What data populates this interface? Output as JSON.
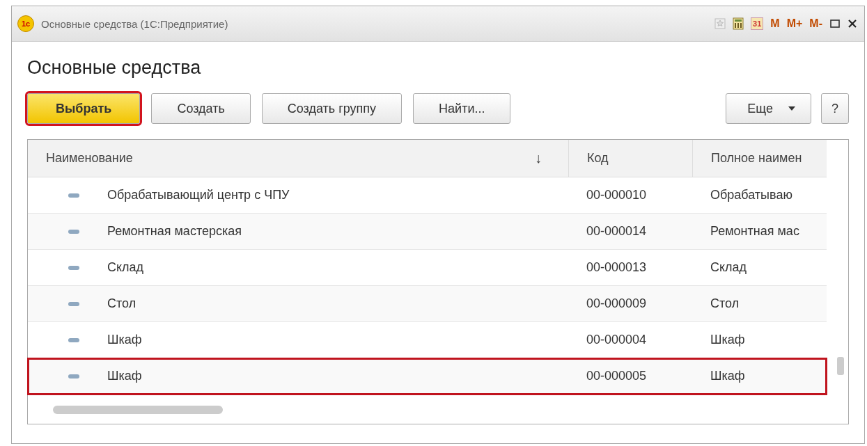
{
  "window": {
    "logo": "1с",
    "title": "Основные средства  (1С:Предприятие)",
    "calendar_day": "31",
    "memory_buttons": [
      "M",
      "M+",
      "M-"
    ]
  },
  "page_title": "Основные средства",
  "buttons": [
    {
      "label": "Выбрать",
      "kind": "default",
      "highlighted": true
    },
    {
      "label": "Создать",
      "kind": "plain",
      "highlighted": false
    },
    {
      "label": "Создать группу",
      "kind": "plain",
      "highlighted": false
    },
    {
      "label": "Найти...",
      "kind": "plain",
      "highlighted": false
    },
    {
      "label": "Еще",
      "kind": "menu",
      "highlighted": false
    },
    {
      "label": "?",
      "kind": "help",
      "highlighted": false
    }
  ],
  "table": {
    "columns": [
      {
        "label": "Наименование",
        "sort": "↓"
      },
      {
        "label": "Код"
      },
      {
        "label": "Полное наимен"
      }
    ],
    "rows": [
      {
        "cells": [
          "Обрабатывающий центр с ЧПУ",
          "00-000010",
          "Обрабатываю"
        ],
        "selected": false
      },
      {
        "cells": [
          "Ремонтная мастерская",
          "00-000014",
          "Ремонтная мас"
        ],
        "selected": false
      },
      {
        "cells": [
          "Склад",
          "00-000013",
          "Склад"
        ],
        "selected": false
      },
      {
        "cells": [
          "Стол",
          "00-000009",
          "Стол"
        ],
        "selected": false
      },
      {
        "cells": [
          "Шкаф",
          "00-000004",
          "Шкаф"
        ],
        "selected": false
      },
      {
        "cells": [
          "Шкаф",
          "00-000005",
          "Шкаф"
        ],
        "selected": true
      }
    ]
  }
}
